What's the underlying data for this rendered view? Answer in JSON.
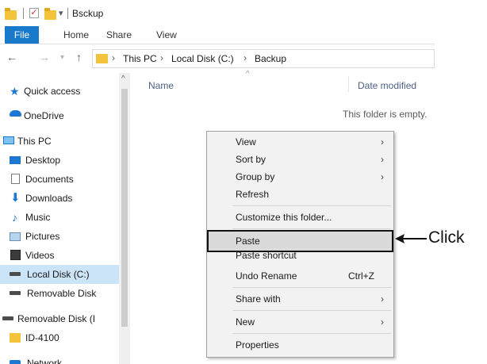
{
  "window": {
    "title": "Bsckup"
  },
  "ribbon": {
    "tabs": [
      "File",
      "Home",
      "Share",
      "View"
    ]
  },
  "address": {
    "path": [
      "This PC",
      "Local Disk (C:)",
      "Backup"
    ],
    "separator": "›"
  },
  "nav_glyphs": {
    "back": "←",
    "forward": "→",
    "up": "↑",
    "qat_dropdown": "▾",
    "scroll_up": "^"
  },
  "nav": [
    {
      "label": "Quick access",
      "icon": "star-icon"
    },
    {
      "label": "OneDrive",
      "icon": "cloud-icon"
    },
    {
      "label": "This PC",
      "icon": "computer-icon"
    },
    {
      "label": "Desktop",
      "icon": "desktop-icon"
    },
    {
      "label": "Documents",
      "icon": "document-icon"
    },
    {
      "label": "Downloads",
      "icon": "download-icon"
    },
    {
      "label": "Music",
      "icon": "music-icon"
    },
    {
      "label": "Pictures",
      "icon": "pictures-icon"
    },
    {
      "label": "Videos",
      "icon": "videos-icon"
    },
    {
      "label": "Local Disk (C:)",
      "icon": "disk-icon",
      "selected": true
    },
    {
      "label": "Removable Disk",
      "icon": "removable-disk-icon"
    },
    {
      "label": "Removable Disk (I",
      "icon": "removable-disk-icon"
    },
    {
      "label": "ID-4100",
      "icon": "folder-icon"
    },
    {
      "label": "Network",
      "icon": "network-icon"
    }
  ],
  "content": {
    "columns": {
      "name": "Name",
      "date_modified": "Date modified",
      "sort_indicator": "^"
    },
    "empty_message": "This folder is empty."
  },
  "context_menu": {
    "items": [
      {
        "label": "View",
        "submenu": true,
        "arrow": "›"
      },
      {
        "label": "Sort by",
        "submenu": true,
        "arrow": "›"
      },
      {
        "label": "Group by",
        "submenu": true,
        "arrow": "›"
      },
      {
        "label": "Refresh"
      },
      {
        "label": "Customize this folder..."
      },
      {
        "label": "Paste",
        "highlighted": true
      },
      {
        "label": "Paste shortcut"
      },
      {
        "label": "Undo Rename",
        "shortcut": "Ctrl+Z"
      },
      {
        "label": "Share with",
        "submenu": true,
        "arrow": "›"
      },
      {
        "label": "New",
        "submenu": true,
        "arrow": "›"
      },
      {
        "label": "Properties"
      }
    ]
  },
  "callout": {
    "text": "Click"
  },
  "colors": {
    "accent": "#1979ca",
    "selection": "#cce4f7",
    "folder": "#f3c43b",
    "menu_bg": "#f2f2f2"
  }
}
